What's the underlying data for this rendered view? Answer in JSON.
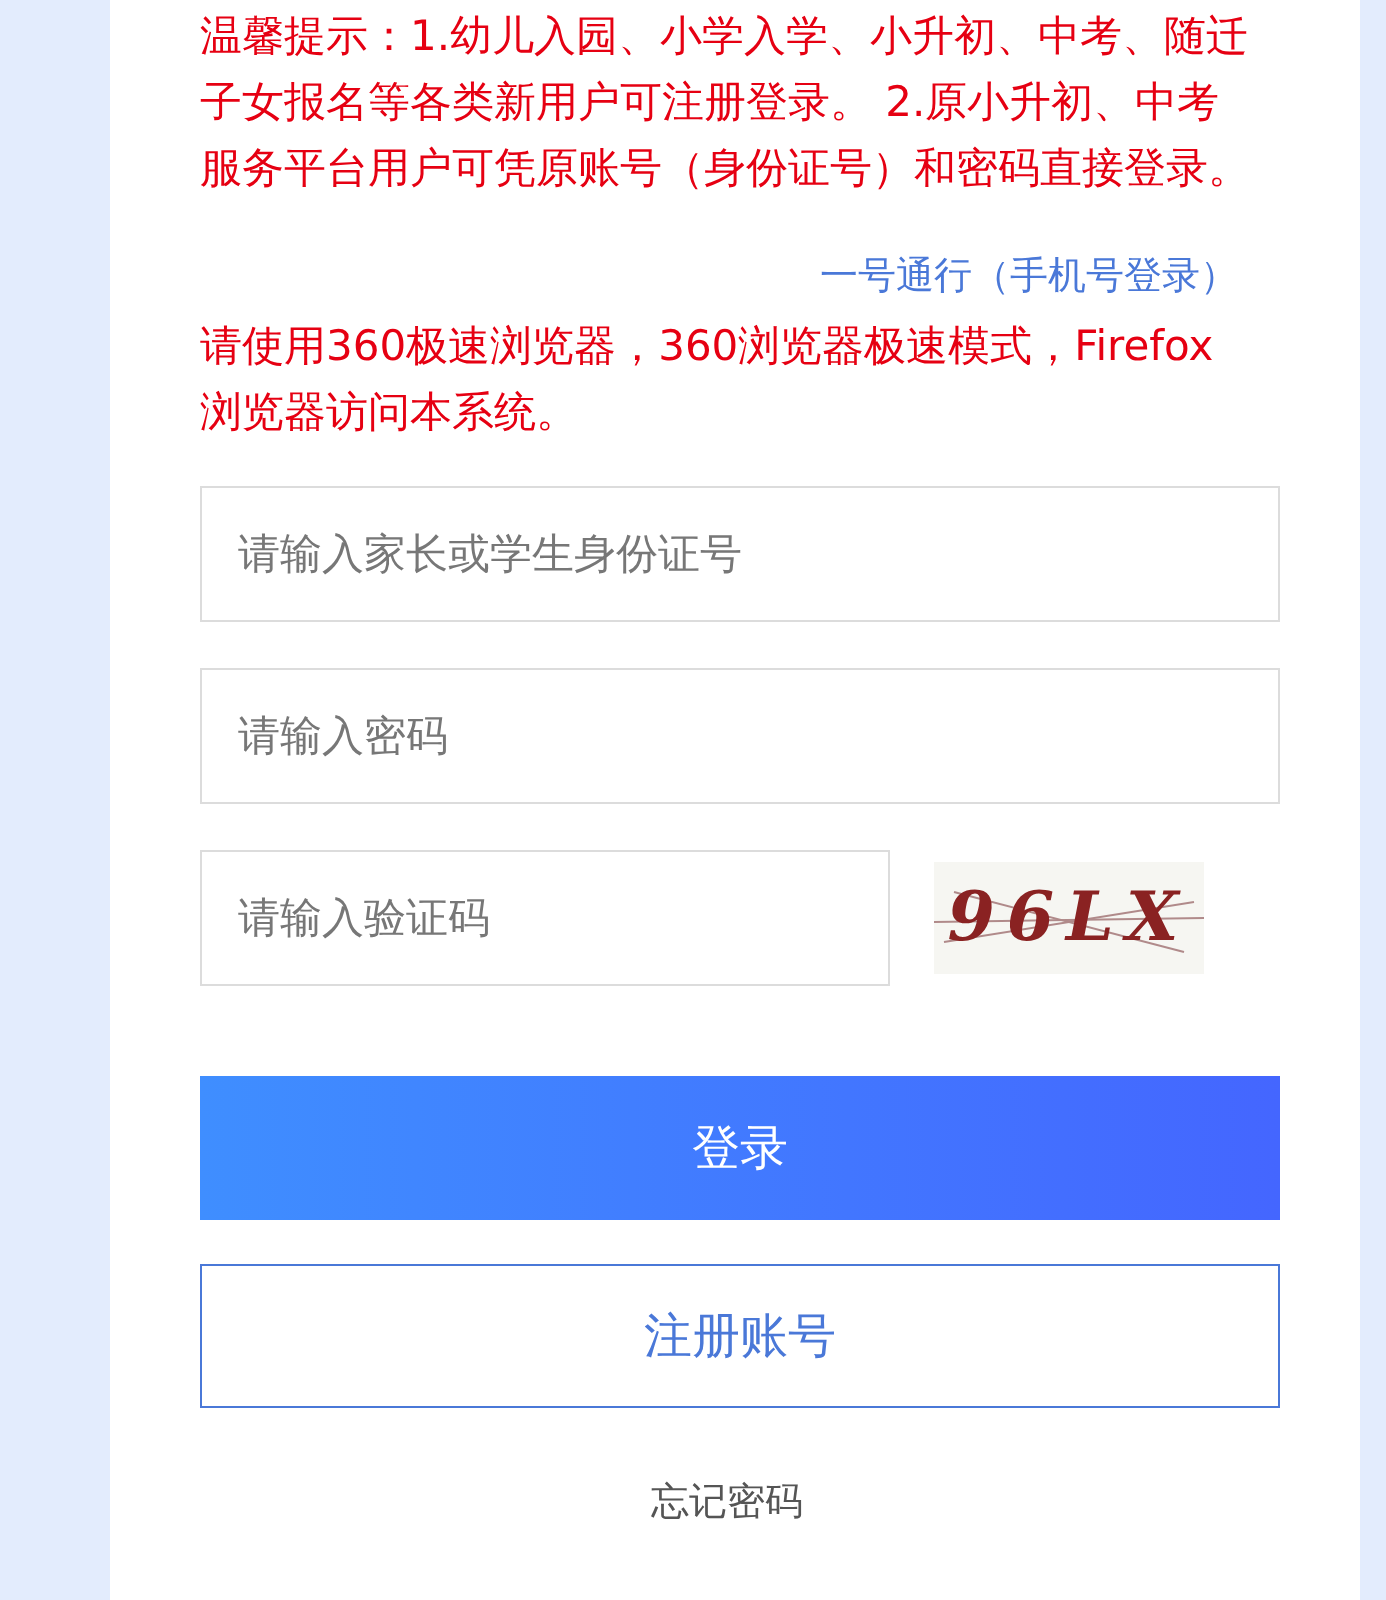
{
  "notice": "温馨提示：1.幼儿入园、小学入学、小升初、中考、随迁子女报名等各类新用户可注册登录。 2.原小升初、中考服务平台用户可凭原账号（身份证号）和密码直接登录。",
  "phone_login_link": "一号通行（手机号登录）",
  "browser_notice": "请使用360极速浏览器，360浏览器极速模式，Firefox浏览器访问本系统。",
  "fields": [
    {
      "placeholder": "请输入家长或学生身份证号",
      "kind": "text"
    },
    {
      "placeholder": "请输入密码",
      "kind": "password"
    },
    {
      "placeholder": "请输入验证码",
      "kind": "captcha"
    }
  ],
  "captcha": {
    "code": "96LX"
  },
  "buttons": [
    {
      "label": "登录",
      "kind": "primary"
    },
    {
      "label": "注册账号",
      "kind": "outline"
    }
  ],
  "forgot_link": "忘记密码"
}
